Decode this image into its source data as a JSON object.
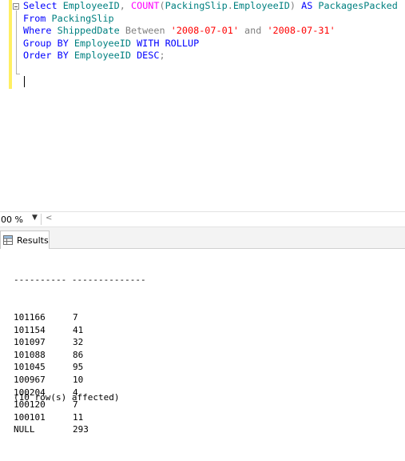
{
  "editor": {
    "lines": [
      [
        {
          "t": "Select",
          "c": "kw"
        },
        {
          "t": " EmployeeID",
          "c": "id"
        },
        {
          "t": ", ",
          "c": "gray"
        },
        {
          "t": "COUNT",
          "c": "fn"
        },
        {
          "t": "(",
          "c": "gray"
        },
        {
          "t": "PackingSlip",
          "c": "id"
        },
        {
          "t": ".",
          "c": "gray"
        },
        {
          "t": "EmployeeID",
          "c": "id"
        },
        {
          "t": ") ",
          "c": "gray"
        },
        {
          "t": "AS",
          "c": "kw"
        },
        {
          "t": " PackagesPacked",
          "c": "id"
        }
      ],
      [
        {
          "t": "From",
          "c": "kw"
        },
        {
          "t": " PackingSlip",
          "c": "id"
        }
      ],
      [
        {
          "t": "Where",
          "c": "kw"
        },
        {
          "t": " ShippedDate ",
          "c": "id"
        },
        {
          "t": "Between",
          "c": "gray"
        },
        {
          "t": " ",
          "c": "gray"
        },
        {
          "t": "'2008-07-01'",
          "c": "str"
        },
        {
          "t": " and ",
          "c": "gray"
        },
        {
          "t": "'2008-07-31'",
          "c": "str"
        }
      ],
      [
        {
          "t": "Group BY",
          "c": "kw"
        },
        {
          "t": " EmployeeID ",
          "c": "id"
        },
        {
          "t": "WITH ROLLUP",
          "c": "kw"
        }
      ],
      [
        {
          "t": "Order BY",
          "c": "kw"
        },
        {
          "t": " EmployeeID ",
          "c": "id"
        },
        {
          "t": "DESC",
          "c": "kw"
        },
        {
          "t": ";",
          "c": "gray"
        }
      ]
    ]
  },
  "zoom": {
    "value": "00 %"
  },
  "results_tab": {
    "label": "Results"
  },
  "results": {
    "separator": "---------- --------------",
    "rows": [
      [
        "101166",
        "7"
      ],
      [
        "101154",
        "41"
      ],
      [
        "101097",
        "32"
      ],
      [
        "101088",
        "86"
      ],
      [
        "101045",
        "95"
      ],
      [
        "100967",
        "10"
      ],
      [
        "100204",
        "4"
      ],
      [
        "100120",
        "7"
      ],
      [
        "100101",
        "11"
      ],
      [
        "NULL",
        "293"
      ]
    ],
    "affected": "(10 row(s) affected)"
  }
}
